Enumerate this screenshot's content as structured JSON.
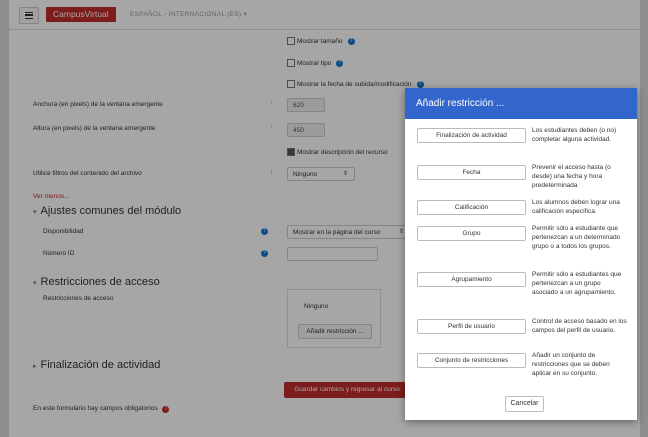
{
  "navbar": {
    "brand": "CampusVirtual",
    "language": "ESPAÑOL - INTERNACIONAL (ES) ▾"
  },
  "checkboxes": {
    "show_size": "Mostrar tamaño",
    "show_type": "Mostrar tipo",
    "show_date": "Mostrar la fecha de subida/modificación",
    "show_desc": "Mostrar descripción del recurso"
  },
  "fields": {
    "width_label": "Anchura (en pixels) de la ventana emergente",
    "width_value": "620",
    "height_label": "Altura (en pixels) de la ventana emergente",
    "height_value": "450",
    "filter_label": "Utilice filtros del contenido del archivo",
    "filter_value": "Ninguno",
    "see_less": "Ver menos...",
    "required_mark": "!"
  },
  "module_section": {
    "title": "Ajustes comunes del módulo",
    "availability_label": "Disponibilidad",
    "availability_value": "Mostrar en la página del curso",
    "id_label": "Número ID"
  },
  "access_section": {
    "title": "Restricciones de acceso",
    "label": "Restricciones de acceso",
    "none": "Ninguno",
    "add_button": "Añadir restricción ..."
  },
  "completion_section": {
    "title": "Finalización de actividad"
  },
  "footer": {
    "save_button": "Guardar cambios y regresar al curso",
    "required_note": "En este formulario hay campos obligatorios"
  },
  "modal": {
    "title": "Añadir restricción ...",
    "options": [
      {
        "label": "Finalización de actividad",
        "desc": "Los estudiantes deben (o no) completar alguna actividad."
      },
      {
        "label": "Fecha",
        "desc": "Prevenir el acceso hasta (o desde) una fecha y hora predeterminada"
      },
      {
        "label": "Calificación",
        "desc": "Los alumnos deben lograr una calificación específica."
      },
      {
        "label": "Grupo",
        "desc": "Permitir sólo a estudiante que pertenezcan a un determinado grupo o a todos los grupos."
      },
      {
        "label": "Agrupamiento",
        "desc": "Permitir sólo a estudiantes que pertenezcan a un grupo asociado a un agrupamiento."
      },
      {
        "label": "Perfil de usuario",
        "desc": "Control de acceso basado en los campos del perfil de usuario."
      },
      {
        "label": "Conjunto de restricciones",
        "desc": "Añadir un conjunto de restricciones que se deben aplicar en su conjunto."
      }
    ],
    "cancel": "Cancelar"
  },
  "colors": {
    "brand": "#c02b2b",
    "modal_header": "#3366cc",
    "help_icon": "#1177d1"
  }
}
